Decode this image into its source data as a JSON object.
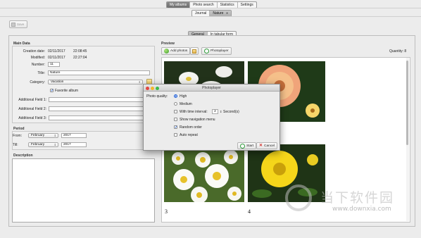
{
  "top_tabs": [
    "My albums",
    "Photo search",
    "Statistics",
    "Settings"
  ],
  "album_tabs": [
    "Journal",
    "Nature"
  ],
  "album_tab_close": "✕",
  "toolbar": {
    "save_label": "Save"
  },
  "view_tabs": [
    "General",
    "In tabular form"
  ],
  "main_data": {
    "section_title": "Main Data",
    "creation_label": "Creation date:",
    "creation_date": "02/11/2017",
    "creation_time": "22:08:45",
    "modified_label": "Modified:",
    "modified_date": "02/11/2017",
    "modified_time": "22:27:04",
    "number_label": "Number:",
    "number_value": "11",
    "title_label": "Title:",
    "title_value": "Nature",
    "category_label": "Category:",
    "category_value": "Vacation",
    "favorite_label": "Favorite album",
    "favorite_checked": true,
    "field1_label": "Additional Field 1:",
    "field2_label": "Additional Field 2:",
    "field3_label": "Additional Field 3:"
  },
  "period": {
    "section_title": "Period",
    "from_label": "From:",
    "from_month": "February",
    "from_year": "2017",
    "till_label": "Till:",
    "till_month": "February",
    "till_year": "2017"
  },
  "description": {
    "section_title": "Description"
  },
  "preview": {
    "section_title": "Preview",
    "add_photos_label": "Add photos",
    "photoplayer_label": "Photoplayer",
    "quantity_label": "Quantity: 8",
    "photo_numbers": [
      "3",
      "4"
    ]
  },
  "dialog": {
    "title": "Photoplayer",
    "quality_label": "Photo quality:",
    "options": [
      {
        "label": "High",
        "kind": "radio",
        "checked": true
      },
      {
        "label": "Medium",
        "kind": "radio",
        "checked": false
      },
      {
        "label": "With time interval:",
        "kind": "check",
        "checked": false
      },
      {
        "label": "Show navigation menu",
        "kind": "check",
        "checked": false
      },
      {
        "label": "Random order",
        "kind": "check",
        "checked": true
      },
      {
        "label": "Auto repeat",
        "kind": "check",
        "checked": false
      }
    ],
    "interval_value": "2",
    "interval_unit": "Second(s)",
    "start_label": "Start",
    "cancel_label": "Cancel"
  },
  "watermark": {
    "cn_text": "当下软件园",
    "url": "www.downxia.com"
  },
  "colors": {
    "accent": "#1a5bd6",
    "start_green": "#2e9a3a",
    "cancel_red": "#d0302a"
  }
}
